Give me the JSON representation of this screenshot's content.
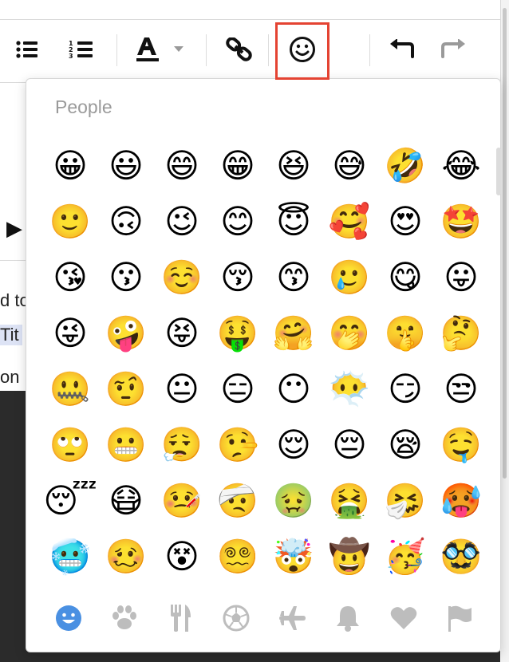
{
  "toolbar": {
    "buttons": [
      {
        "name": "bulleted-list-icon"
      },
      {
        "name": "numbered-list-icon"
      },
      {
        "name": "text-color-icon"
      },
      {
        "name": "link-icon"
      },
      {
        "name": "emoji-icon"
      },
      {
        "name": "undo-icon"
      },
      {
        "name": "redo-icon"
      }
    ],
    "accent_color": "#e44332"
  },
  "editor": {
    "fragments": [
      "d to",
      "Tit",
      "on"
    ]
  },
  "emoji_picker": {
    "section_title": "People",
    "emojis": [
      "😀",
      "😃",
      "😄",
      "😁",
      "😆",
      "😅",
      "🤣",
      "😂",
      "🙂",
      "🙃",
      "😉",
      "😊",
      "😇",
      "🥰",
      "😍",
      "🤩",
      "😘",
      "😗",
      "☺️",
      "😚",
      "😙",
      "🥲",
      "😋",
      "😛",
      "😜",
      "🤪",
      "😝",
      "🤑",
      "🤗",
      "🤭",
      "🤫",
      "🤔",
      "🤐",
      "🤨",
      "😐",
      "😑",
      "😶",
      "😶‍🌫️",
      "😏",
      "😒",
      "🙄",
      "😬",
      "😮‍💨",
      "🤥",
      "😌",
      "😔",
      "😪",
      "🤤",
      "😴",
      "😷",
      "🤒",
      "🤕",
      "🤢",
      "🤮",
      "🤧",
      "🥵",
      "🥶",
      "🥴",
      "😵",
      "😵‍💫",
      "🤯",
      "🤠",
      "🥳",
      "🥸"
    ],
    "categories": [
      {
        "name": "smileys-category-icon",
        "active": true
      },
      {
        "name": "animals-category-icon",
        "active": false
      },
      {
        "name": "food-category-icon",
        "active": false
      },
      {
        "name": "activity-category-icon",
        "active": false
      },
      {
        "name": "travel-category-icon",
        "active": false
      },
      {
        "name": "objects-category-icon",
        "active": false
      },
      {
        "name": "symbols-category-icon",
        "active": false
      },
      {
        "name": "flags-category-icon",
        "active": false
      }
    ],
    "active_color": "#4a90e2",
    "inactive_color": "#bdbdbd"
  }
}
